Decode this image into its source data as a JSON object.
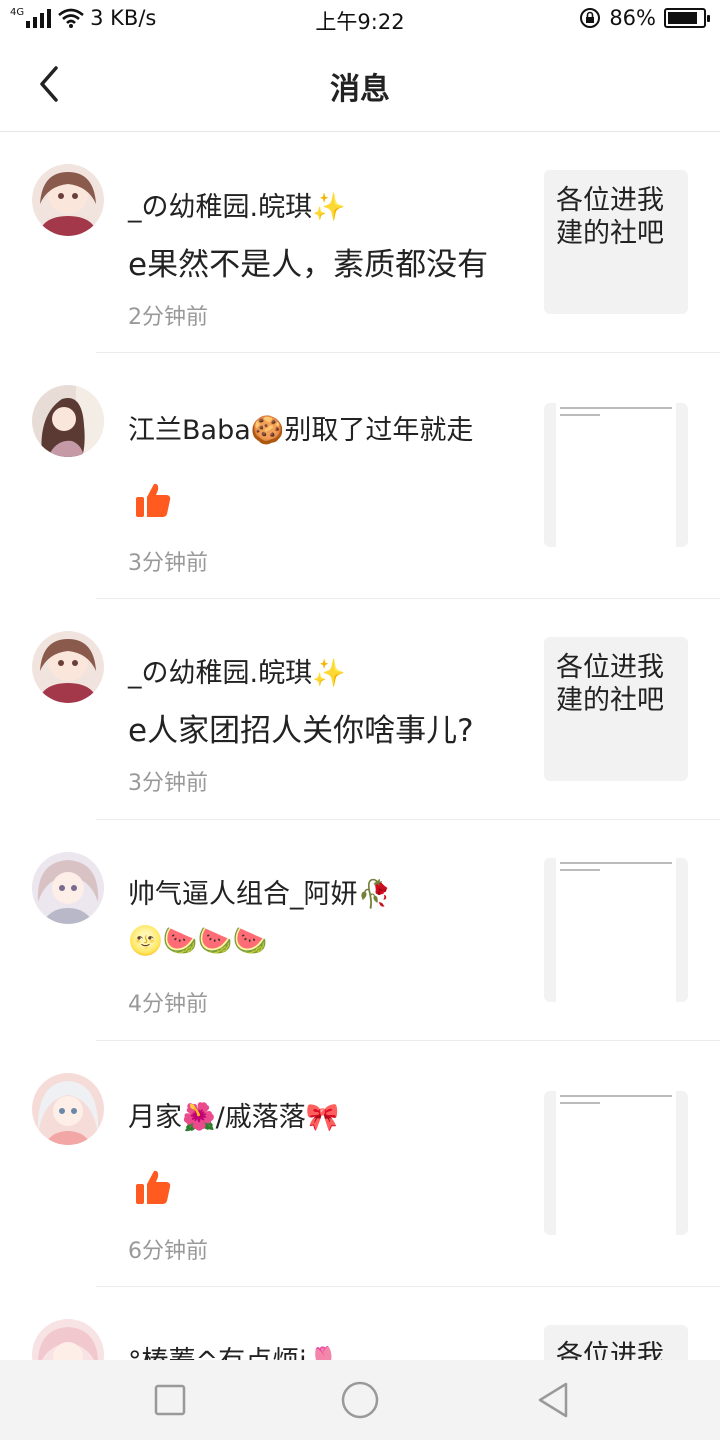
{
  "status_bar": {
    "network": "4G",
    "speed": "3 KB/s",
    "time": "上午9:22",
    "battery": "86%",
    "battery_level": 0.86
  },
  "header": {
    "title": "消息"
  },
  "messages": [
    {
      "name": "_の幼稚园.皖琪✨",
      "content": "e果然不是人，素质都没有",
      "time": "2分钟前",
      "thumb_text": "各位进我建的社吧",
      "avatar_color": "#c98c8c"
    },
    {
      "name": "江兰Baba🍪别取了过年就走",
      "content": "👍",
      "time": "3分钟前",
      "thumb_text": "",
      "avatar_color": "#a67a80"
    },
    {
      "name": "_の幼稚园.皖琪✨",
      "content": "e人家团招人关你啥事儿?",
      "time": "3分钟前",
      "thumb_text": "各位进我建的社吧",
      "avatar_color": "#c98c8c"
    },
    {
      "name": "帅气逼人组合_阿妍🥀",
      "content": "🌝🍉🍉🍉",
      "time": "4分钟前",
      "thumb_text": "",
      "avatar_color": "#d8c7d6"
    },
    {
      "name": "月家🌺/戚落落🎀",
      "content": "👍",
      "time": "6分钟前",
      "thumb_text": "",
      "avatar_color": "#f0c9c5"
    },
    {
      "name": "°榛蓁^有点烦i🌷",
      "content": "",
      "time": "",
      "thumb_text": "各位进我",
      "avatar_color": "#f2c8cf"
    }
  ]
}
